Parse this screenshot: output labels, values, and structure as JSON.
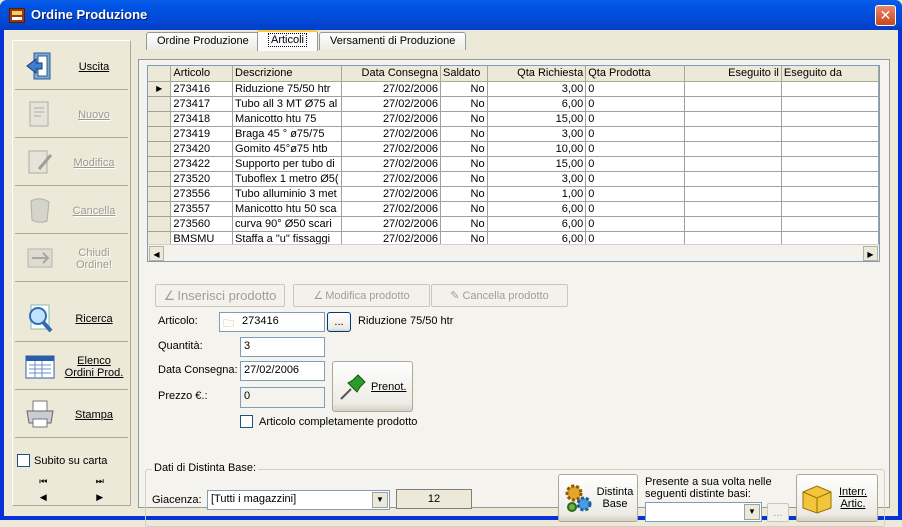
{
  "window": {
    "title": "Ordine Produzione"
  },
  "sidebar": {
    "buttons": [
      {
        "label": "Uscita",
        "icon": "exit-door-icon",
        "enabled": true
      },
      {
        "label": "Nuovo",
        "icon": "new-document-icon",
        "enabled": false
      },
      {
        "label": "Modifica",
        "icon": "edit-document-icon",
        "enabled": false
      },
      {
        "label": "Cancella",
        "icon": "delete-icon",
        "enabled": false
      },
      {
        "label": "Chiudi Ordine!",
        "icon": "close-order-icon",
        "enabled": false
      },
      {
        "label": "Ricerca",
        "icon": "magnifier-icon",
        "enabled": true
      },
      {
        "label": "Elenco Ordini Prod.",
        "icon": "list-window-icon",
        "enabled": true
      },
      {
        "label": "Stampa",
        "icon": "printer-icon",
        "enabled": true
      }
    ],
    "print_checkbox_label": "Subito su carta",
    "nav": {
      "first": "⏮",
      "last": "⏭",
      "prev": "◀",
      "next": "▶"
    }
  },
  "tabs": [
    {
      "label": "Ordine Produzione",
      "active": false
    },
    {
      "label": "Articoli",
      "active": true
    },
    {
      "label": "Versamenti di Produzione",
      "active": false
    }
  ],
  "grid": {
    "columns": [
      "Articolo",
      "Descrizione",
      "Data Consegna",
      "Saldato",
      "Qta Richiesta",
      "Qta Prodotta",
      "Eseguito il",
      "Eseguito da"
    ],
    "rows": [
      [
        "273416",
        "Riduzione 75/50 htr",
        "27/02/2006",
        "No",
        "3,00",
        "0",
        "",
        ""
      ],
      [
        "273417",
        "Tubo all 3 MT Ø75 al",
        "27/02/2006",
        "No",
        "6,00",
        "0",
        "",
        ""
      ],
      [
        "273418",
        "Manicotto htu 75",
        "27/02/2006",
        "No",
        "15,00",
        "0",
        "",
        ""
      ],
      [
        "273419",
        "Braga 45 ° ø75/75",
        "27/02/2006",
        "No",
        "3,00",
        "0",
        "",
        ""
      ],
      [
        "273420",
        "Gomito 45°ø75 htb",
        "27/02/2006",
        "No",
        "10,00",
        "0",
        "",
        ""
      ],
      [
        "273422",
        "Supporto per tubo di",
        "27/02/2006",
        "No",
        "15,00",
        "0",
        "",
        ""
      ],
      [
        "273520",
        "Tuboflex 1 metro Ø5(",
        "27/02/2006",
        "No",
        "3,00",
        "0",
        "",
        ""
      ],
      [
        "273556",
        "Tubo alluminio 3 met",
        "27/02/2006",
        "No",
        "1,00",
        "0",
        "",
        ""
      ],
      [
        "273557",
        "Manicotto htu 50 sca",
        "27/02/2006",
        "No",
        "6,00",
        "0",
        "",
        ""
      ],
      [
        "273560",
        "curva 90°  Ø50 scari",
        "27/02/2006",
        "No",
        "6,00",
        "0",
        "",
        ""
      ],
      [
        "BMSMU",
        "Staffa a \"u\" fissaggi",
        "27/02/2006",
        "No",
        "6,00",
        "0",
        "",
        ""
      ]
    ],
    "selected_row": 0,
    "row_marker": "▶"
  },
  "actions": {
    "insert": "Inserisci prodotto",
    "modify": "Modifica prodotto",
    "delete": "Cancella prodotto"
  },
  "form": {
    "articolo_label": "Articolo:",
    "articolo_value": "273416",
    "articolo_browse": "...",
    "articolo_desc": "Riduzione 75/50 htr",
    "quantita_label": "Quantità:",
    "quantita_value": "3",
    "data_label": "Data Consegna:",
    "data_value": "27/02/2006",
    "prezzo_label": "Prezzo €.:",
    "prezzo_value": "0",
    "prenot_label": "Prenot.",
    "completed_label": "Articolo completamente prodotto"
  },
  "distinta": {
    "legend": "Dati di Distinta Base:",
    "giacenza_label": "Giacenza:",
    "giacenza_select": "[Tutti i magazzini]",
    "giacenza_value": "12",
    "distinta_button": "Distinta Base",
    "presente_label": "Presente a sua volta nelle seguenti distinte basi:",
    "presente_browse": "...",
    "interr_button": "Interr. Artic."
  },
  "colors": {
    "titlebar": "#0054E3",
    "face": "#ECE9D8",
    "panel": "#F4F3EE",
    "giacenza_bg": "#ECE9D8"
  }
}
